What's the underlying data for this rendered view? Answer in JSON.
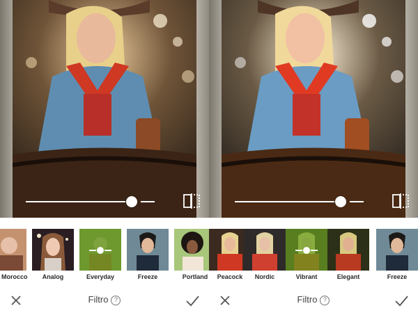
{
  "panes": [
    {
      "filters": [
        {
          "label": "Morocco",
          "selected": false
        },
        {
          "label": "Analog",
          "selected": false
        },
        {
          "label": "Everyday",
          "selected": true
        },
        {
          "label": "Freeze",
          "selected": false
        },
        {
          "label": "Portland",
          "selected": false
        }
      ],
      "bottom_bar": {
        "title": "Filtro",
        "help_icon": "?"
      },
      "slider": {
        "value": 0.8
      }
    },
    {
      "filters": [
        {
          "label": "Peacock",
          "selected": false
        },
        {
          "label": "Nordic",
          "selected": false
        },
        {
          "label": "Vibrant",
          "selected": true
        },
        {
          "label": "Elegant",
          "selected": false
        },
        {
          "label": "Freeze",
          "selected": false
        }
      ],
      "bottom_bar": {
        "title": "Filtro",
        "help_icon": "?"
      },
      "slider": {
        "value": 0.8
      }
    }
  ],
  "colors": {
    "selected_filter": "#64a01e",
    "text": "#2a2a2a",
    "icon": "#555555"
  },
  "icons": {
    "close": "close-icon",
    "confirm": "check-icon",
    "compare": "compare-icon",
    "help": "help-icon"
  }
}
